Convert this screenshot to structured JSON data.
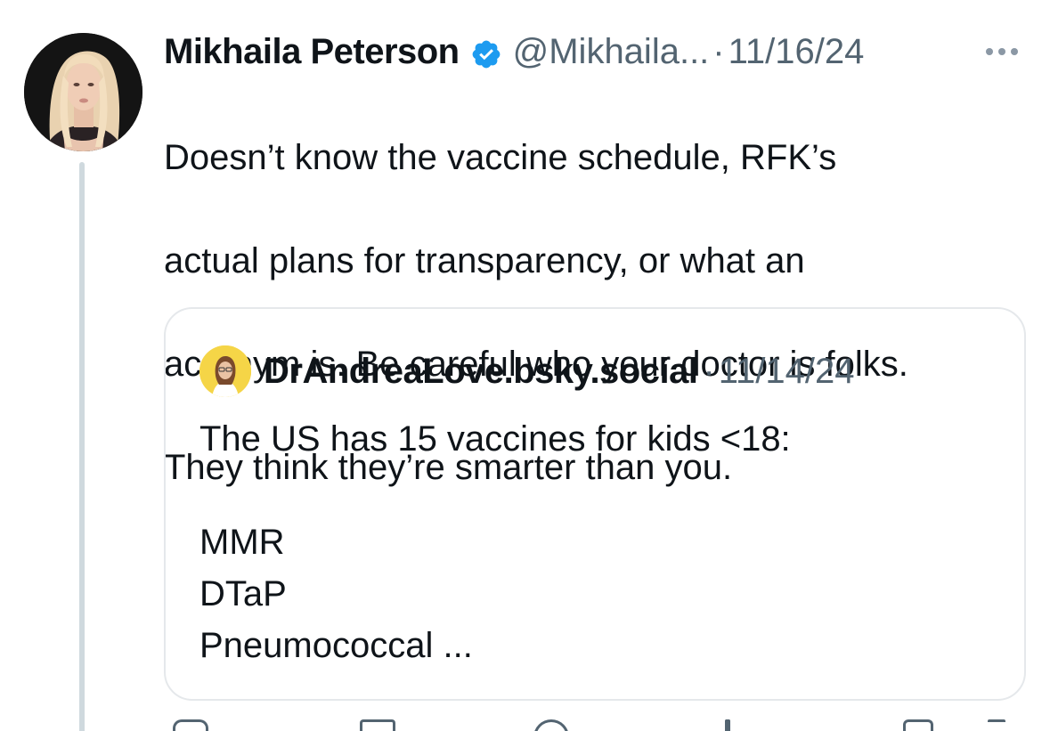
{
  "tweet": {
    "author_name": "Mikhaila Peterson",
    "handle": "@Mikhaila...",
    "separator": "·",
    "date": "11/16/24",
    "text_lines": [
      "Doesn’t know the vaccine schedule, RFK’s",
      "actual plans for transparency, or what an",
      "acronym is. Be careful who your doctor is folks.",
      "They think they’re smarter than you."
    ],
    "verified_icon": "verified-badge-icon",
    "verified_color": "#1d9bf0",
    "more_icon": "more-dots-icon"
  },
  "quote": {
    "author_name": "DrAndreaLove.bsky.social",
    "separator": "·",
    "date": "11/14/24",
    "lines": [
      "The US has 15 vaccines for kids <18:",
      "",
      "MMR",
      "DTaP",
      "Pneumococcal ..."
    ]
  },
  "colors": {
    "text": "#0f1419",
    "secondary": "#536471",
    "border": "#e5e8eb",
    "thread_line": "#cfd9de",
    "quote_avatar_bg": "#f5d547"
  }
}
